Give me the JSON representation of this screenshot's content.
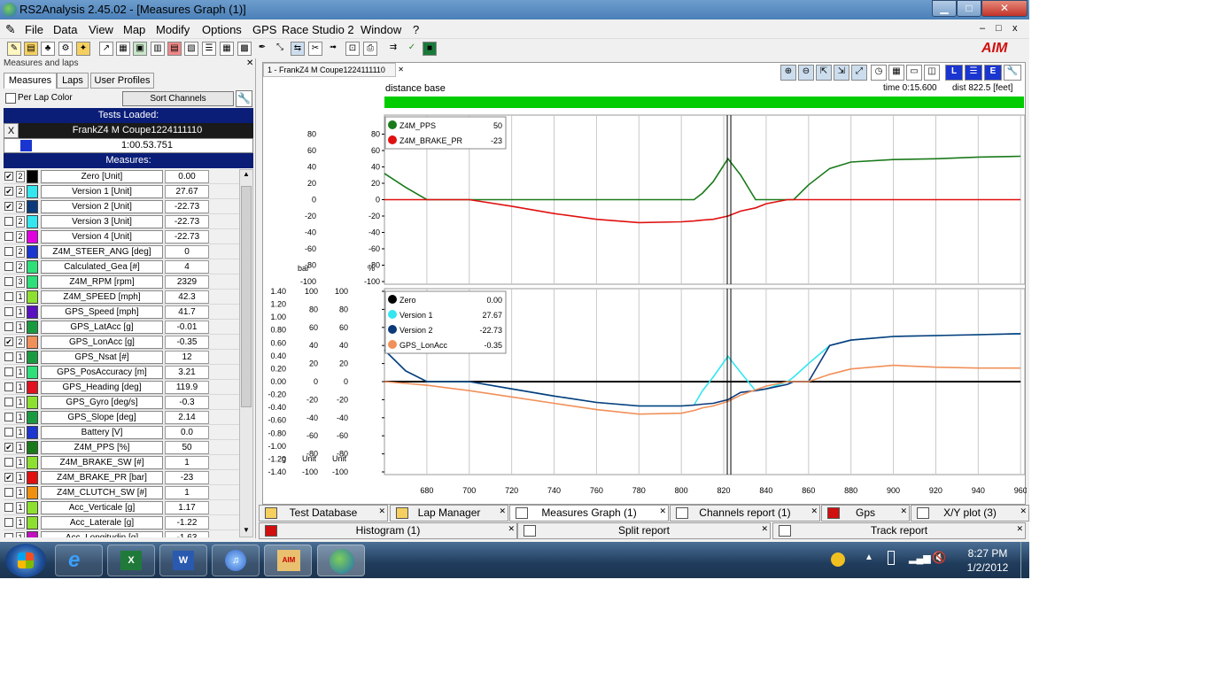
{
  "window": {
    "title": "RS2Analysis 2.45.02 - [Measures Graph (1)]",
    "min": "▁",
    "max": "□",
    "close": "✕",
    "mdi_min": "–",
    "mdi_max": "□",
    "mdi_close": "x"
  },
  "menu": [
    "File",
    "Data",
    "View",
    "Map",
    "Modify",
    "Options",
    "GPS",
    "Race Studio 2",
    "Window",
    "?"
  ],
  "brand": "AIM",
  "left": {
    "title": "Measures and laps",
    "tabs": [
      "Measures",
      "Laps",
      "User Profiles"
    ],
    "per_lap_color": "Per Lap  Color",
    "sort_button": "Sort Channels",
    "tests_loaded": "Tests Loaded:",
    "test_close": "X",
    "test_name": "FrankZ4 M Coupe1224111110",
    "lap_time": "1:00.53.751",
    "measures_header": "Measures:",
    "rows": [
      {
        "check": "✔",
        "n": "2",
        "color": "#000000",
        "name": "Zero       [Unit]",
        "val": "0.00"
      },
      {
        "check": "✔",
        "n": "2",
        "color": "#33e6f0",
        "name": "Version  1     [Unit]",
        "val": "27.67"
      },
      {
        "check": "✔",
        "n": "2",
        "color": "#0b3a7a",
        "name": "Version  2     [Unit]",
        "val": "-22.73"
      },
      {
        "check": "",
        "n": "2",
        "color": "#33e6f0",
        "name": "Version  3     [Unit]",
        "val": "-22.73"
      },
      {
        "check": "",
        "n": "2",
        "color": "#e000e0",
        "name": "Version  4     [Unit]",
        "val": "-22.73"
      },
      {
        "check": "",
        "n": "2",
        "color": "#1a35d0",
        "name": "Z4M_STEER_ANG      [deg]",
        "val": "0"
      },
      {
        "check": "",
        "n": "2",
        "color": "#2ee07a",
        "name": "Calculated_Gea       [#]",
        "val": "4"
      },
      {
        "check": "",
        "n": "3",
        "color": "#2ee07a",
        "name": "Z4M_RPM      [rpm]",
        "val": "2329"
      },
      {
        "check": "",
        "n": "1",
        "color": "#8ee030",
        "name": "Z4M_SPEED      [mph]",
        "val": "42.3"
      },
      {
        "check": "",
        "n": "1",
        "color": "#5a10c0",
        "name": "GPS_Speed      [mph]",
        "val": "41.7"
      },
      {
        "check": "",
        "n": "1",
        "color": "#1a9a40",
        "name": "GPS_LatAcc      [g]",
        "val": "-0.01"
      },
      {
        "check": "✔",
        "n": "2",
        "color": "#f0905a",
        "name": "GPS_LonAcc      [g]",
        "val": "-0.35"
      },
      {
        "check": "",
        "n": "1",
        "color": "#1a9a40",
        "name": "GPS_Nsat      [#]",
        "val": "12"
      },
      {
        "check": "",
        "n": "1",
        "color": "#2ee07a",
        "name": "GPS_PosAccuracy    [m]",
        "val": "3.21"
      },
      {
        "check": "",
        "n": "1",
        "color": "#e01020",
        "name": "GPS_Heading      [deg]",
        "val": "119.9"
      },
      {
        "check": "",
        "n": "1",
        "color": "#8ee030",
        "name": "GPS_Gyro      [deg/s]",
        "val": "-0.3"
      },
      {
        "check": "",
        "n": "1",
        "color": "#1a9a40",
        "name": "GPS_Slope      [deg]",
        "val": "2.14"
      },
      {
        "check": "",
        "n": "1",
        "color": "#1a35d0",
        "name": "Battery      [V]",
        "val": "0.0"
      },
      {
        "check": "✔",
        "n": "1",
        "color": "#1a7a1a",
        "name": "Z4M_PPS      [%]",
        "val": "50"
      },
      {
        "check": "",
        "n": "1",
        "color": "#8ee030",
        "name": "Z4M_BRAKE_SW      [#]",
        "val": "1"
      },
      {
        "check": "✔",
        "n": "1",
        "color": "#e01010",
        "name": "Z4M_BRAKE_PR      [bar]",
        "val": "-23"
      },
      {
        "check": "",
        "n": "1",
        "color": "#f09010",
        "name": "Z4M_CLUTCH_SW      [#]",
        "val": "1"
      },
      {
        "check": "",
        "n": "1",
        "color": "#8ee030",
        "name": "Acc_Verticale      [g]",
        "val": "1.17"
      },
      {
        "check": "",
        "n": "1",
        "color": "#8ee030",
        "name": "Acc_Laterale      [g]",
        "val": "-1.22"
      },
      {
        "check": "",
        "n": "1",
        "color": "#c010c0",
        "name": "Acc_Longitudin    [g]",
        "val": "-1.63"
      }
    ]
  },
  "graph": {
    "tab": "1 - FrankZ4 M Coupe1224111110",
    "tab_close": "✕",
    "distance_base": "distance base",
    "time": "time 0:15.600",
    "dist": "dist 822.5 [feet]",
    "top_units": {
      "left": "bar",
      "right": "%"
    },
    "bottom_units": {
      "u1": "g",
      "u2": "Unit",
      "u3": "Unit"
    },
    "legend_top": [
      {
        "name": "Z4M_PPS",
        "val": "50",
        "color": "#1a7a1a"
      },
      {
        "name": "Z4M_BRAKE_PR",
        "val": "-23",
        "color": "#e01010"
      }
    ],
    "legend_bottom": [
      {
        "name": "Zero",
        "val": "0.00",
        "color": "#000000"
      },
      {
        "name": "Version 1",
        "val": "27.67",
        "color": "#33e6f0"
      },
      {
        "name": "Version 2",
        "val": "-22.73",
        "color": "#0b3a7a"
      },
      {
        "name": "GPS_LonAcc",
        "val": "-0.35",
        "color": "#f0905a"
      }
    ]
  },
  "chart_data": [
    {
      "type": "line",
      "x": [
        660,
        670,
        680,
        700,
        720,
        740,
        760,
        780,
        800,
        806,
        810,
        815,
        822,
        828,
        835,
        840,
        850,
        853,
        860,
        870,
        880,
        900,
        920,
        940,
        960
      ],
      "series": [
        {
          "name": "Z4M_PPS",
          "color": "#1a7a1a",
          "y": [
            32,
            15,
            0,
            0,
            0,
            0,
            0,
            0,
            0,
            0,
            8,
            22,
            50,
            30,
            0,
            0,
            0,
            0,
            18,
            38,
            46,
            49,
            50,
            52,
            53
          ]
        },
        {
          "name": "Z4M_BRAKE_PR",
          "color": "#e01010",
          "y": [
            0,
            0,
            0,
            0,
            -8,
            -17,
            -24,
            -28,
            -27,
            -26,
            -25,
            -24,
            -20,
            -14,
            -10,
            -5,
            0,
            0,
            0,
            0,
            0,
            0,
            0,
            0,
            0
          ]
        }
      ],
      "xlim": [
        660,
        962
      ],
      "ylim": [
        -100,
        100
      ],
      "yticks": [
        -100,
        -80,
        -60,
        -40,
        -20,
        0,
        20,
        40,
        60,
        80
      ],
      "ylabel_left": "bar",
      "ylabel_right": "%"
    },
    {
      "type": "line",
      "x": [
        660,
        670,
        680,
        700,
        720,
        740,
        760,
        780,
        800,
        806,
        810,
        815,
        822,
        828,
        835,
        840,
        850,
        853,
        860,
        870,
        880,
        900,
        920,
        940,
        960
      ],
      "series": [
        {
          "name": "Zero",
          "color": "#000000",
          "y": [
            0,
            0,
            0,
            0,
            0,
            0,
            0,
            0,
            0,
            0,
            0,
            0,
            0,
            0,
            0,
            0,
            0,
            0,
            0,
            0,
            0,
            0,
            0,
            0,
            0
          ]
        },
        {
          "name": "Version 1",
          "color": "#33e6f0",
          "y": [
            35,
            12,
            0,
            0,
            -8,
            -16,
            -23,
            -27,
            -27,
            -26,
            -10,
            5,
            28,
            10,
            -10,
            -8,
            0,
            5,
            20,
            40,
            46,
            50,
            51,
            52,
            53
          ]
        },
        {
          "name": "Version 2",
          "color": "#0b3a7a",
          "y": [
            35,
            12,
            0,
            0,
            -8,
            -16,
            -23,
            -27,
            -27,
            -26,
            -25,
            -24,
            -20,
            -12,
            -10,
            -8,
            -3,
            0,
            0,
            40,
            46,
            50,
            51,
            52,
            53
          ]
        },
        {
          "name": "GPS_LonAcc",
          "color": "#f0905a",
          "y": [
            0,
            -2,
            -4,
            -10,
            -17,
            -24,
            -31,
            -36,
            -35,
            -32,
            -29,
            -27,
            -22,
            -15,
            -9,
            -5,
            0,
            0,
            0,
            8,
            14,
            18,
            16,
            15,
            15
          ]
        }
      ],
      "xlim": [
        660,
        962
      ],
      "ylim": [
        -100,
        100
      ],
      "xticks": [
        680,
        700,
        720,
        740,
        760,
        780,
        800,
        820,
        840,
        860,
        880,
        900,
        920,
        940,
        960
      ],
      "yticks": [
        -100,
        -80,
        -60,
        -40,
        -20,
        0,
        20,
        40,
        60,
        80,
        100
      ],
      "g_ticks": [
        "-1.40",
        "-1.20",
        "-1.00",
        "-0.80",
        "-0.60",
        "-0.40",
        "-0.20",
        "0.00",
        "0.20",
        "0.40",
        "0.60",
        "0.80",
        "1.00",
        "1.20",
        "1.40"
      ],
      "cursor_x": 822.5
    }
  ],
  "bottom_tabs": [
    {
      "label": "Test Database",
      "icon": "folder-icon",
      "icolor": "#f5d060"
    },
    {
      "label": "Lap Manager",
      "icon": "folder-icon",
      "icolor": "#f5d060"
    },
    {
      "label": "Measures Graph (1)",
      "icon": "graph-icon",
      "icolor": "#ffffff"
    },
    {
      "label": "Channels report (1)",
      "icon": "report-icon",
      "icolor": "#ffffff"
    },
    {
      "label": "Gps",
      "icon": "gps-icon",
      "icolor": "#d01010"
    },
    {
      "label": "X/Y plot (3)",
      "icon": "xy-icon",
      "icolor": "#ffffff"
    },
    {
      "label": "Histogram (1)",
      "icon": "histogram-icon",
      "icolor": "#d01010"
    },
    {
      "label": "Split report",
      "icon": "split-icon",
      "icolor": "#ffffff"
    },
    {
      "label": "Track report",
      "icon": "track-icon",
      "icolor": "#ffffff"
    }
  ],
  "taskbar": {
    "time": "8:27 PM",
    "date": "1/2/2012"
  }
}
